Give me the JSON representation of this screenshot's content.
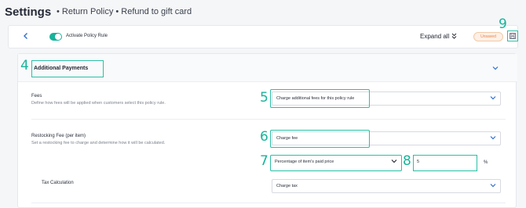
{
  "header": {
    "title": "Settings",
    "crumbs": "• Return Policy • Refund to gift card"
  },
  "topbar": {
    "back_icon": "chevron-left-icon",
    "toggle_label": "Activate Policy Rule",
    "toggle_on": true,
    "expand_label": "Expand all",
    "expand_icon": "double-chevron-down-icon",
    "status_badge": "Unsaved",
    "save_icon": "floppy-disk-icon"
  },
  "section": {
    "title": "Additional Payments",
    "collapse_icon": "chevron-down-icon",
    "fees": {
      "label": "Fees",
      "description": "Define how fees will be applied when customers select this policy rule.",
      "select_value": "Charge additional fees for this policy rule"
    },
    "restocking": {
      "label": "Restocking Fee (per item)",
      "description": "Set a restocking fee to charge and determine how it will be calculated.",
      "select_value": "Charge fee",
      "method_value": "Percentage of item's paid price",
      "amount_value": "5",
      "unit": "%"
    },
    "tax": {
      "label": "Tax Calculation",
      "select_value": "Charge tax"
    }
  },
  "markers": [
    "4",
    "5",
    "6",
    "7",
    "8",
    "9"
  ],
  "colors": {
    "accent": "#2bbfa4",
    "link": "#2f6fd1",
    "badge_text": "#e8844a",
    "badge_bg": "#fdf0e6"
  }
}
